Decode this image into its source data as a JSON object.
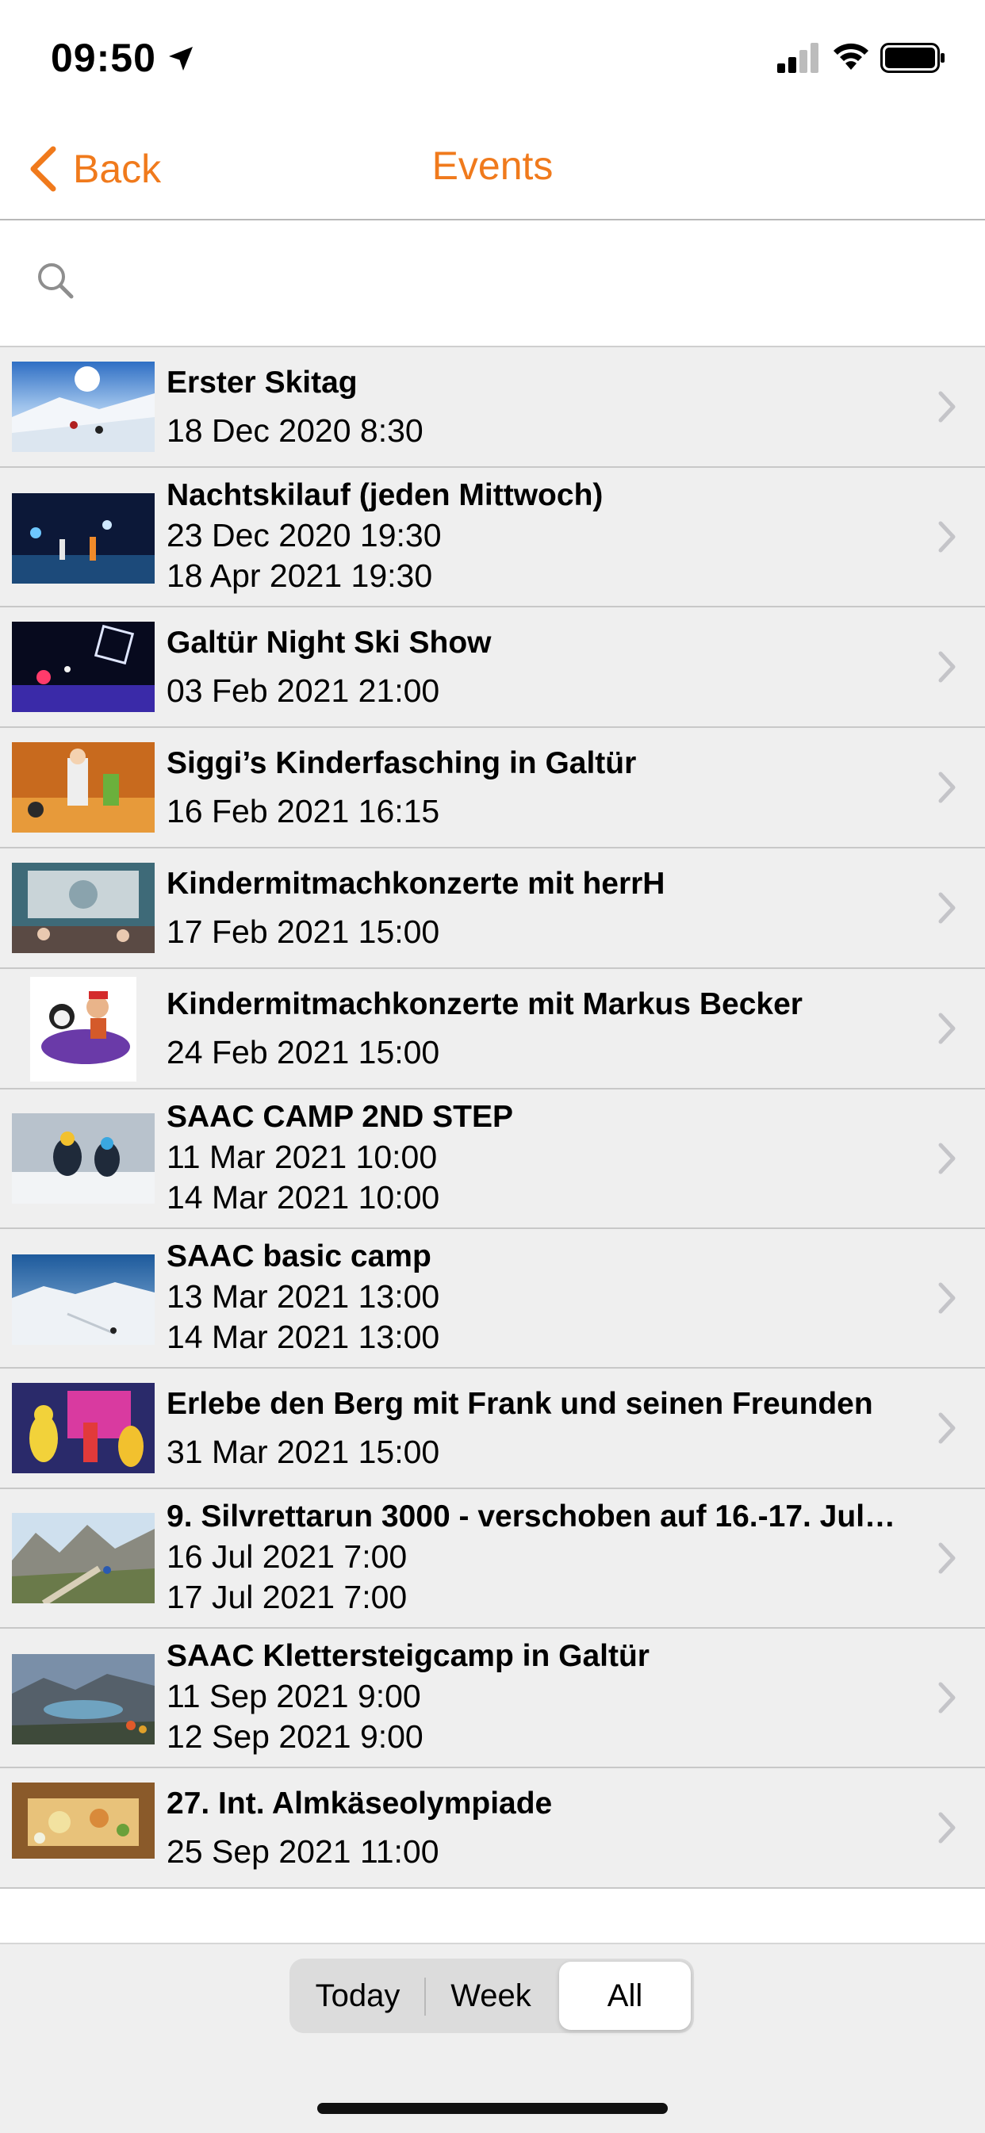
{
  "status_bar": {
    "time": "09:50"
  },
  "nav": {
    "back_label": "Back",
    "title": "Events"
  },
  "search": {
    "placeholder": "",
    "value": ""
  },
  "events": [
    {
      "title": "Erster Skitag",
      "dates": [
        "18 Dec 2020 8:30"
      ]
    },
    {
      "title": "Nachtskilauf (jeden Mittwoch)",
      "dates": [
        "23 Dec 2020 19:30",
        "18 Apr 2021 19:30"
      ]
    },
    {
      "title": "Galtür Night Ski Show",
      "dates": [
        "03 Feb 2021 21:00"
      ]
    },
    {
      "title": "Siggi’s Kinderfasching in Galtür",
      "dates": [
        "16 Feb 2021 16:15"
      ]
    },
    {
      "title": "Kindermitmachkonzerte mit herrH",
      "dates": [
        "17 Feb 2021 15:00"
      ]
    },
    {
      "title": "Kindermitmachkonzerte mit Markus Becker",
      "dates": [
        "24 Feb 2021 15:00"
      ]
    },
    {
      "title": "SAAC CAMP 2ND STEP",
      "dates": [
        "11 Mar 2021 10:00",
        "14 Mar 2021 10:00"
      ]
    },
    {
      "title": "SAAC basic camp",
      "dates": [
        "13 Mar 2021 13:00",
        "14 Mar 2021 13:00"
      ]
    },
    {
      "title": "Erlebe den Berg mit Frank und seinen Freunden",
      "dates": [
        "31 Mar 2021 15:00"
      ]
    },
    {
      "title": "9. Silvrettarun 3000  - verschoben auf 16.-17. Juli...",
      "dates": [
        "16 Jul 2021 7:00",
        "17 Jul 2021 7:00"
      ]
    },
    {
      "title": "SAAC Klettersteigcamp in Galtür",
      "dates": [
        "11 Sep 2021 9:00",
        "12 Sep 2021 9:00"
      ]
    },
    {
      "title": "27. Int. Almkäseolympiade",
      "dates": [
        "25 Sep 2021 11:00"
      ]
    }
  ],
  "filter": {
    "options": [
      "Today",
      "Week",
      "All"
    ],
    "selected": "All"
  },
  "colors": {
    "accent": "#f07a1c",
    "list_bg": "#efefef"
  }
}
